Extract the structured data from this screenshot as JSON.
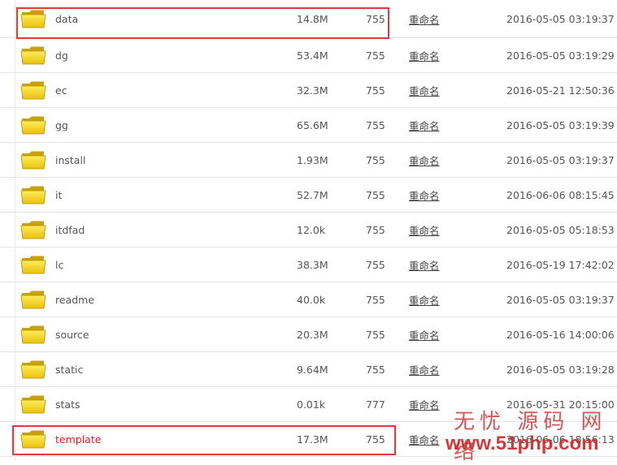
{
  "files": [
    {
      "name": "data",
      "size": "14.8M",
      "perm": "755",
      "rename": "重命名",
      "date": "2016-05-05 03:19:37"
    },
    {
      "name": "dg",
      "size": "53.4M",
      "perm": "755",
      "rename": "重命名",
      "date": "2016-05-05 03:19:29"
    },
    {
      "name": "ec",
      "size": "32.3M",
      "perm": "755",
      "rename": "重命名",
      "date": "2016-05-21 12:50:36"
    },
    {
      "name": "gg",
      "size": "65.6M",
      "perm": "755",
      "rename": "重命名",
      "date": "2016-05-05 03:19:39"
    },
    {
      "name": "install",
      "size": "1.93M",
      "perm": "755",
      "rename": "重命名",
      "date": "2016-05-05 03:19:37"
    },
    {
      "name": "it",
      "size": "52.7M",
      "perm": "755",
      "rename": "重命名",
      "date": "2016-06-06 08:15:45"
    },
    {
      "name": "itdfad",
      "size": "12.0k",
      "perm": "755",
      "rename": "重命名",
      "date": "2016-05-05 05:18:53"
    },
    {
      "name": "lc",
      "size": "38.3M",
      "perm": "755",
      "rename": "重命名",
      "date": "2016-05-19 17:42:02"
    },
    {
      "name": "readme",
      "size": "40.0k",
      "perm": "755",
      "rename": "重命名",
      "date": "2016-05-05 03:19:37"
    },
    {
      "name": "source",
      "size": "20.3M",
      "perm": "755",
      "rename": "重命名",
      "date": "2016-05-16 14:00:06"
    },
    {
      "name": "static",
      "size": "9.64M",
      "perm": "755",
      "rename": "重命名",
      "date": "2016-05-05 03:19:28"
    },
    {
      "name": "stats",
      "size": "0.01k",
      "perm": "777",
      "rename": "重命名",
      "date": "2016-05-31 20:15:00"
    },
    {
      "name": "template",
      "size": "17.3M",
      "perm": "755",
      "rename": "重命名",
      "date": "2016-06-06 18:56:13"
    }
  ],
  "highlight": {
    "border_color": "#e0393e",
    "name_color": "#d42020"
  },
  "icon": "folder-icon",
  "watermark": {
    "cn": "无忧 源码 网络",
    "url": "www.51php.com"
  }
}
